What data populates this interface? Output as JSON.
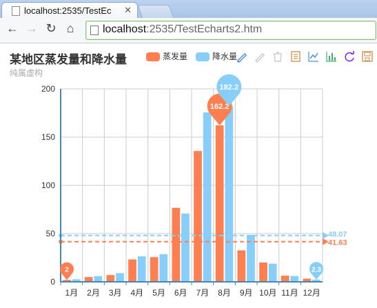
{
  "browser": {
    "tab_title": "localhost:2535/TestEc",
    "url_host": "localhost",
    "url_path": ":2535/TestEcharts2.htm"
  },
  "chart_title": "某地区蒸发量和降水量",
  "chart_subtitle": "纯属虚构",
  "legend": [
    {
      "label": "蒸发量",
      "color": "#ff7f50"
    },
    {
      "label": "降水量",
      "color": "#87cefa"
    }
  ],
  "toolbox": [
    "mark-icon",
    "mark-undo-icon",
    "mark-clear-icon",
    "data-view-icon",
    "line-chart-icon",
    "bar-chart-icon",
    "restore-icon",
    "save-image-icon"
  ],
  "chart_data": {
    "type": "bar",
    "title": "某地区蒸发量和降水量",
    "subtitle": "纯属虚构",
    "categories": [
      "1月",
      "2月",
      "3月",
      "4月",
      "5月",
      "6月",
      "7月",
      "8月",
      "9月",
      "10月",
      "11月",
      "12月"
    ],
    "series": [
      {
        "name": "蒸发量",
        "color": "#ff7f50",
        "values": [
          2.0,
          4.9,
          7.0,
          23.2,
          25.6,
          76.7,
          135.6,
          162.2,
          32.6,
          20.0,
          6.4,
          3.3
        ],
        "max_label": "162.2",
        "min_label": "2",
        "average": 41.63
      },
      {
        "name": "降水量",
        "color": "#87cefa",
        "values": [
          2.6,
          5.9,
          9.0,
          26.4,
          28.7,
          70.7,
          175.6,
          182.2,
          48.7,
          18.8,
          6.0,
          2.3
        ],
        "max_label": "182.2",
        "min_label": "2.3",
        "average": 48.07
      }
    ],
    "yticks": [
      "0",
      "50",
      "100",
      "150",
      "200"
    ],
    "ylim": [
      0,
      200
    ],
    "average_labels": [
      "48.07",
      "41.63"
    ],
    "grid": true
  }
}
